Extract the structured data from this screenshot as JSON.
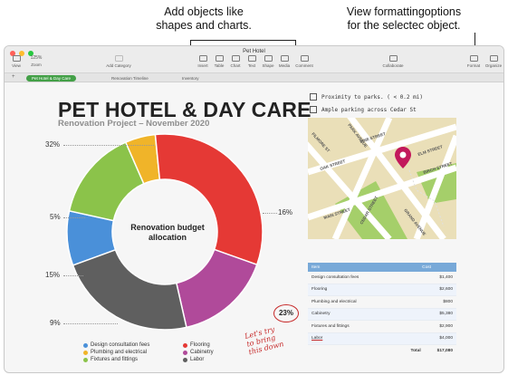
{
  "callouts": {
    "left_line1": "Add objects like",
    "left_line2": "shapes and charts.",
    "right_line1": "View formattingoptions",
    "right_line2": "for the selectec object."
  },
  "window": {
    "title": "Pet Hotel",
    "traffic_colors": [
      "#ff5f57",
      "#febc2e",
      "#28c840"
    ]
  },
  "toolbar": {
    "view": "View",
    "zoom_value": "125%",
    "zoom": "Zoom",
    "add_category": "Add Category",
    "insert": "Insert",
    "table": "Table",
    "chart": "Chart",
    "text": "Text",
    "shape": "Shape",
    "media": "Media",
    "comment": "Comment",
    "collaborate": "Collaborate",
    "format": "Format",
    "organize": "Organize"
  },
  "tabs": [
    "Pet Hotel & Day Care",
    "Renovation Timeline",
    "Inventory"
  ],
  "sheet": {
    "title": "PET HOTEL & DAY CARE",
    "subtitle": "Renovation Project – November 2020"
  },
  "donut": {
    "center_line1": "Renovation budget",
    "center_line2": "allocation",
    "pct_32": "32%",
    "pct_5": "5%",
    "pct_15": "15%",
    "pct_9": "9%",
    "pct_16": "16%",
    "pct_23": "23%"
  },
  "chart_data": {
    "type": "pie",
    "title": "Renovation budget allocation",
    "categories": [
      "Design consultation fees",
      "Plumbing and electrical",
      "Fixtures and fittings",
      "Flooring",
      "Cabinetry",
      "Labor"
    ],
    "values": [
      9,
      5,
      15,
      32,
      16,
      23
    ],
    "colors": [
      "#4a90d9",
      "#f0b429",
      "#8bc34a",
      "#e53935",
      "#b04a9a",
      "#5f5f5f"
    ],
    "legend_position": "bottom"
  },
  "annotation": {
    "line1": "Let's try",
    "line2": "to bring",
    "line3": "this down"
  },
  "checklist": [
    "Proximity to parks. ( < 0.2 mi)",
    "Ample parking across Cedar St"
  ],
  "map": {
    "streets": [
      "FILMORE ST",
      "PINE STREET",
      "OAK STREET",
      "ELM STREET",
      "PARK AVENUE",
      "BIRCH STREET",
      "CEDAR STREET",
      "GRAND AVENUE",
      "MAIN STREET"
    ],
    "pin_color": "#c2185b"
  },
  "budget_table": {
    "headers": [
      "Item",
      "Cost"
    ],
    "rows": [
      [
        "Design consultation fees",
        "$1,400"
      ],
      [
        "Flooring",
        "$2,600"
      ],
      [
        "Plumbing and electrical",
        "$800"
      ],
      [
        "Cabinetry",
        "$5,380"
      ],
      [
        "Fixtures and fittings",
        "$2,900"
      ],
      [
        "Labor",
        "$4,000"
      ]
    ],
    "total_label": "Total",
    "total_value": "$17,080"
  }
}
